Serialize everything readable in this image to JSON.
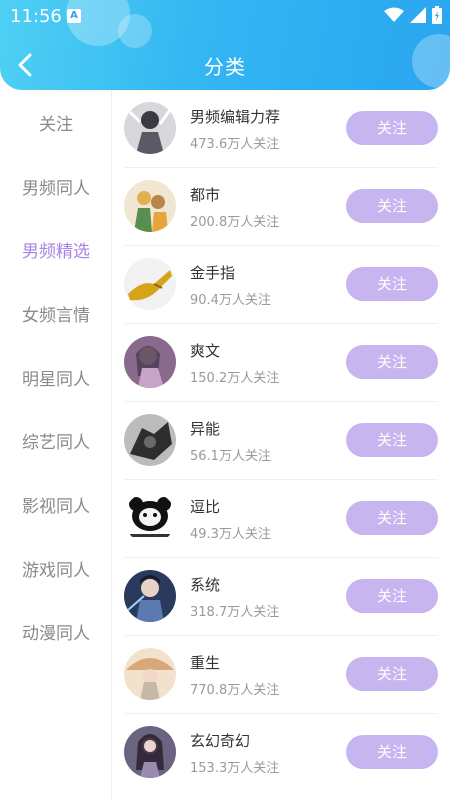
{
  "status_bar": {
    "time": "11:56",
    "app_badge": "A"
  },
  "header": {
    "title": "分类"
  },
  "sidebar": {
    "items": [
      {
        "label": "关注",
        "active": false
      },
      {
        "label": "男频同人",
        "active": false
      },
      {
        "label": "男频精选",
        "active": true
      },
      {
        "label": "女频言情",
        "active": false
      },
      {
        "label": "明星同人",
        "active": false
      },
      {
        "label": "综艺同人",
        "active": false
      },
      {
        "label": "影视同人",
        "active": false
      },
      {
        "label": "游戏同人",
        "active": false
      },
      {
        "label": "动漫同人",
        "active": false
      }
    ]
  },
  "list": {
    "items": [
      {
        "name": "男频编辑力荐",
        "followers": "473.6万人关注",
        "button": "关注",
        "avatar_icon": "anime-character-avatar"
      },
      {
        "name": "都市",
        "followers": "200.8万人关注",
        "button": "关注",
        "avatar_icon": "city-women-avatar"
      },
      {
        "name": "金手指",
        "followers": "90.4万人关注",
        "button": "关注",
        "avatar_icon": "golden-hand-avatar"
      },
      {
        "name": "爽文",
        "followers": "150.2万人关注",
        "button": "关注",
        "avatar_icon": "anime-girl-avatar"
      },
      {
        "name": "异能",
        "followers": "56.1万人关注",
        "button": "关注",
        "avatar_icon": "mech-avatar"
      },
      {
        "name": "逗比",
        "followers": "49.3万人关注",
        "button": "关注",
        "avatar_icon": "panda-meme-avatar"
      },
      {
        "name": "系统",
        "followers": "318.7万人关注",
        "button": "关注",
        "avatar_icon": "anime-boy-avatar"
      },
      {
        "name": "重生",
        "followers": "770.8万人关注",
        "button": "关注",
        "avatar_icon": "umbrella-girl-avatar"
      },
      {
        "name": "玄幻奇幻",
        "followers": "153.3万人关注",
        "button": "关注",
        "avatar_icon": "fantasy-girl-avatar"
      }
    ]
  },
  "colors": {
    "header_start": "#4fd0f4",
    "header_end": "#2aa6f0",
    "active_tab": "#a883e8",
    "follow_button": "#c6b5ef"
  }
}
